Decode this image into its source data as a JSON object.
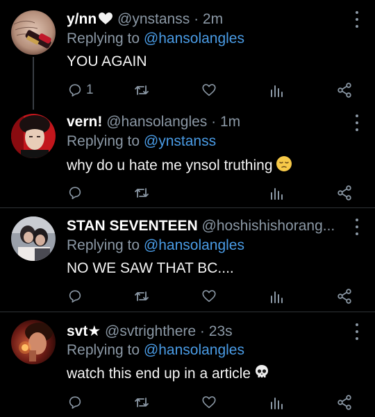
{
  "tweets": [
    {
      "name": "y/nn",
      "handle": "@ynstanss",
      "time": "2m",
      "reply_prefix": "Replying to",
      "reply_to": "@hansolangles",
      "text": "YOU AGAIN",
      "reply_count": "1"
    },
    {
      "name": "vern!",
      "handle": "@hansolangles",
      "time": "1m",
      "reply_prefix": "Replying to",
      "reply_to": "@ynstanss",
      "text": "why do u hate me ynsol truthing"
    },
    {
      "name": "STAN SEVENTEEN",
      "handle": "@hoshishishorang...",
      "reply_prefix": "Replying to",
      "reply_to": "@hansolangles",
      "text": "NO WE SAW THAT BC...."
    },
    {
      "name": "svt★",
      "handle": "@svtrighthere",
      "time": "23s",
      "reply_prefix": "Replying to",
      "reply_to": "@hansolangles",
      "text": "watch this end up in a article"
    }
  ],
  "separator": "·",
  "icons": {
    "reply": "reply-icon",
    "retweet": "retweet-icon",
    "like": "heart-icon",
    "analytics": "analytics-icon",
    "share": "share-icon",
    "more": "more-vertical-icon"
  },
  "colors": {
    "background": "#000000",
    "text": "#e7e9ea",
    "muted": "#8b98a5",
    "mention": "#4a9ce6",
    "divider": "#2f3336"
  }
}
